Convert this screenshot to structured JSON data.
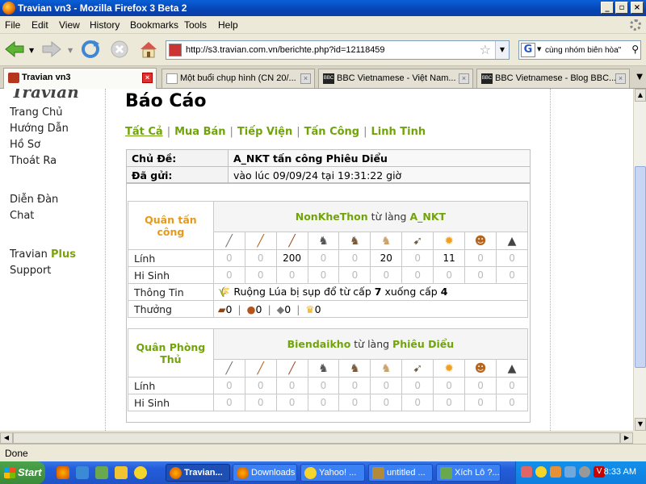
{
  "window": {
    "title": "Travian vn3 - Mozilla Firefox 3 Beta 2"
  },
  "menu": [
    "File",
    "Edit",
    "View",
    "History",
    "Bookmarks",
    "Tools",
    "Help"
  ],
  "nav": {
    "url": "http://s3.travian.com.vn/berichte.php?id=12118459",
    "search_value": "cùng nhóm biên hòa\""
  },
  "tabs": [
    {
      "label": "Travian vn3",
      "active": true
    },
    {
      "label": "Một buổi chụp hình (CN 20/...",
      "active": false
    },
    {
      "label": "BBC Vietnamese - Việt Nam...",
      "active": false
    },
    {
      "label": "BBC Vietnamese - Blog BBC...",
      "active": false
    }
  ],
  "sidebar": {
    "logo": "Travian",
    "items": [
      "Trang Chủ",
      "Hướng Dẫn",
      "Hồ Sơ",
      "Thoát Ra",
      "Diễn Đàn",
      "Chat",
      "Travian",
      "Support"
    ],
    "plus_word": "Plus"
  },
  "page": {
    "heading": "Báo Cáo",
    "filters": [
      "Tất Cả",
      "Mua Bán",
      "Tiếp Viện",
      "Tấn Công",
      "Linh Tinh"
    ],
    "separator": "|"
  },
  "report": {
    "subject_label": "Chủ Đề:",
    "subject_value": "A_NKT tấn công Phiêu Diểu",
    "sent_label": "Đã gửi:",
    "sent_value": "vào lúc 09/09/24 tại 19:31:22 giờ"
  },
  "attacker": {
    "header": "Quân tấn công",
    "player": "NonKheThon",
    "from_text": "từ làng",
    "village": "A_NKT",
    "troops_label": "Lính",
    "troops": [
      "0",
      "0",
      "200",
      "0",
      "0",
      "20",
      "0",
      "11",
      "0",
      "0"
    ],
    "casualties_label": "Hi Sinh",
    "casualties": [
      "0",
      "0",
      "0",
      "0",
      "0",
      "0",
      "0",
      "0",
      "0",
      "0"
    ],
    "info_label": "Thông Tin",
    "info_pre": "Ruộng Lúa bị sụp đổ từ cấp",
    "info_from": "7",
    "info_mid": "xuống cấp",
    "info_to": "4",
    "bounty_label": "Thưởng",
    "bounty": [
      "0",
      "0",
      "0",
      "0"
    ]
  },
  "defender": {
    "header": "Quân Phòng Thủ",
    "player": "Biendaikho",
    "from_text": "từ làng",
    "village": "Phiêu Diểu",
    "troops_label": "Lính",
    "troops": [
      "0",
      "0",
      "0",
      "0",
      "0",
      "0",
      "0",
      "0",
      "0",
      "0"
    ],
    "casualties_label": "Hi Sinh",
    "casualties": [
      "0",
      "0",
      "0",
      "0",
      "0",
      "0",
      "0",
      "0",
      "0",
      "0"
    ]
  },
  "unit_icons": [
    "clubswinger-icon",
    "spearman-icon",
    "axeman-icon",
    "scout-icon",
    "paladin-icon",
    "teutonic-knight-icon",
    "ram-icon",
    "catapult-icon",
    "chief-icon",
    "settler-icon"
  ],
  "status": "Done",
  "taskbar": {
    "start": "Start",
    "buttons": [
      "Travian...",
      "Downloads",
      "Yahoo! ...",
      "untitled ...",
      "Xích Lô ?..."
    ],
    "clock": "8:33 AM"
  },
  "colors": {
    "green": "#71a40a",
    "orange": "#e69a1c"
  }
}
